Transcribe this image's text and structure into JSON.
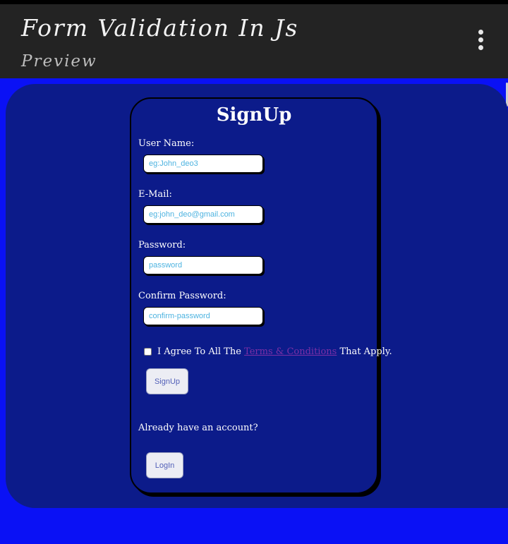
{
  "header": {
    "title": "Form Validation In Js",
    "subtitle": "Preview",
    "menu_icon": "kebab-menu-icon"
  },
  "form": {
    "heading": "SignUp",
    "fields": [
      {
        "label": "User Name:",
        "placeholder": "eg:John_deo3",
        "value": ""
      },
      {
        "label": "E-Mail:",
        "placeholder": "eg:john_deo@gmail.com",
        "value": ""
      },
      {
        "label": "Password:",
        "placeholder": "password",
        "value": ""
      },
      {
        "label": "Confirm Password:",
        "placeholder": "confirm-password",
        "value": ""
      }
    ],
    "agree": {
      "prefix": "I Agree To All The",
      "link_text": "Terms & Conditions",
      "suffix": "That Apply.",
      "checked": false
    },
    "signup_button": "SignUp",
    "account_prompt": "Already have an account?",
    "login_button": "LogIn"
  },
  "colors": {
    "page_background": "#0a11f5",
    "panel_background": "#0c1b8a",
    "header_background": "#232323",
    "link": "#7b2fa6"
  }
}
